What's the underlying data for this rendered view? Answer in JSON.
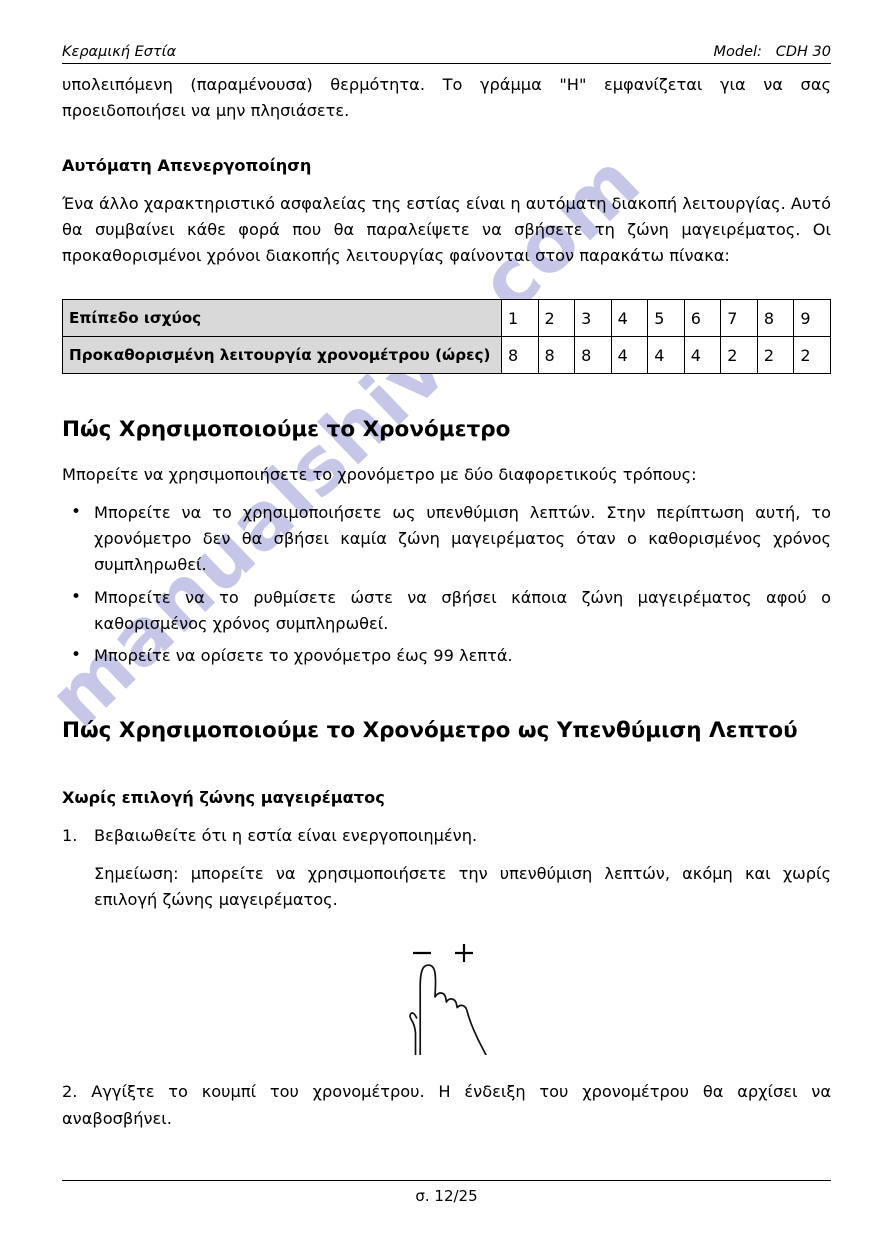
{
  "header": {
    "left_title": "Κεραμική Εστία",
    "right_label": "Model:",
    "right_model": "CDH 30",
    "right_combined": "Model:   CDH 30"
  },
  "watermark": {
    "text": "manualshive.com",
    "color": "#c3c3e8"
  },
  "body": {
    "continued_paragraph": "υπολειπόμενη (παραμένουσα) θερμότητα. Το γράμμα \"Η\" εμφανίζεται για να σας προειδοποιήσει να μην πλησιάσετε.",
    "auto_off_heading": "Αυτόματη Απενεργοποίηση",
    "auto_off_paragraph": "Ένα άλλο χαρακτηριστικό ασφαλείας της εστίας είναι η αυτόματη διακοπή λειτουργίας. Αυτό θα συμβαίνει κάθε φορά που θα παραλείψετε να σβήσετε τη ζώνη μαγειρέματος. Οι προκαθορισμένοι χρόνοι διακοπής λειτουργίας φαίνονται στον παρακάτω πίνακα:",
    "timer_heading": "Πώς Χρησιμοποιούμε το Χρονόμετρο",
    "timer_intro": "Μπορείτε να χρησιμοποιήσετε το χρονόμετρο με δύο διαφορετικούς τρόπους:",
    "timer_bullets": [
      "Μπορείτε να το χρησιμοποιήσετε ως υπενθύμιση λεπτών. Στην περίπτωση αυτή, το χρονόμετρο δεν θα σβήσει καμία ζώνη μαγειρέματος όταν ο καθορισμένος χρόνος συμπληρωθεί.",
      "Μπορείτε να το ρυθμίσετε ώστε να σβήσει κάποια ζώνη μαγειρέματος αφού ο καθορισμένος χρόνος συμπληρωθεί.",
      "Μπορείτε να ορίσετε το χρονόμετρο έως 99 λεπτά."
    ],
    "minute_reminder_heading": "Πώς Χρησιμοποιούμε το Χρονόμετρο ως Υπενθύμιση Λεπτού",
    "no_zone_heading": "Χωρίς επιλογή ζώνης μαγειρέματος",
    "step1_number": "1.",
    "step1_text": "Βεβαιωθείτε ότι η εστία είναι ενεργοποιημένη.",
    "step1_note": "Σημείωση: μπορείτε να χρησιμοποιήσετε την υπενθύμιση λεπτών, ακόμη και χωρίς επιλογή ζώνης μαγειρέματος.",
    "step2_text": "2.  Αγγίξτε το κουμπί του χρονομέτρου. Η ένδειξη του χρονομέτρου θα αρχίσει να αναβοσβήνει."
  },
  "figure": {
    "minus_symbol": "−",
    "plus_symbol": "+",
    "caption": ""
  },
  "table": {
    "row_labels": [
      "Επίπεδο ισχύος",
      "Προκαθορισμένη λειτουργία χρονομέτρου (ώρες)"
    ],
    "power_levels": [
      "1",
      "2",
      "3",
      "4",
      "5",
      "6",
      "7",
      "8",
      "9"
    ],
    "default_hours": [
      "8",
      "8",
      "8",
      "4",
      "4",
      "4",
      "2",
      "2",
      "2"
    ]
  },
  "footer": {
    "page_label": "σ. 12/25"
  }
}
